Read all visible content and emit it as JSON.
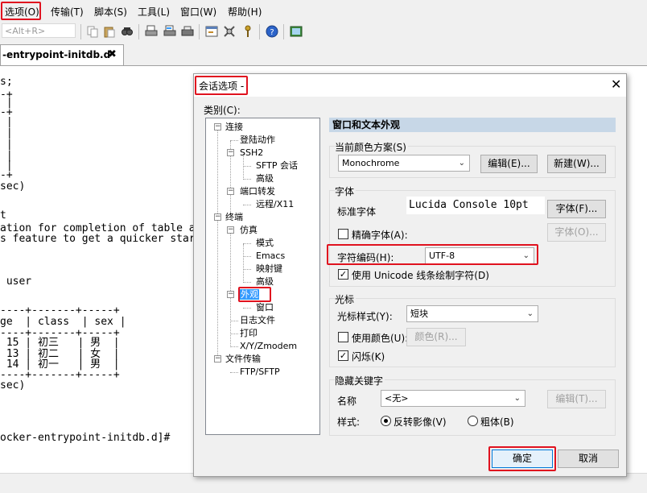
{
  "menubar": {
    "items": [
      {
        "label": "选项(O)"
      },
      {
        "label": "传输(T)"
      },
      {
        "label": "脚本(S)"
      },
      {
        "label": "工具(L)"
      },
      {
        "label": "窗口(W)"
      },
      {
        "label": "帮助(H)"
      }
    ]
  },
  "toolbar": {
    "hotkey_placeholder": "<Alt+R>"
  },
  "session_tab": {
    "label": "-entrypoint-initdb.d",
    "close": "✖"
  },
  "terminal": {
    "lines": [
      "s;",
      "-+",
      " |",
      "-+",
      " |",
      " |",
      " |",
      " |",
      " |",
      "-+",
      "sec)",
      "",
      "t",
      "ation for completion of table a",
      "s feature to get a quicker star",
      "",
      "",
      " user",
      "",
      "",
      "----+-------+-----+",
      "ge  | class  | sex |",
      "----+-------+-----+",
      " 15 | 初三   | 男  |",
      " 13 | 初二   | 女  |",
      " 14 | 初一   | 男  |",
      "----+-------+-----+",
      "sec)",
      "",
      "",
      "ocker-entrypoint-initdb.d]#"
    ]
  },
  "dialog": {
    "title": "会话选项 -",
    "close": "✕",
    "category_label": "类别(C):",
    "tree": [
      {
        "label": "连接"
      },
      {
        "label": "登陆动作"
      },
      {
        "label": "SSH2"
      },
      {
        "label": "SFTP 会话"
      },
      {
        "label": "高级"
      },
      {
        "label": "端口转发"
      },
      {
        "label": "远程/X11"
      },
      {
        "label": "终端"
      },
      {
        "label": "仿真"
      },
      {
        "label": "模式"
      },
      {
        "label": "Emacs"
      },
      {
        "label": "映射键"
      },
      {
        "label": "高级"
      },
      {
        "label": "外观"
      },
      {
        "label": "窗口"
      },
      {
        "label": "日志文件"
      },
      {
        "label": "打印"
      },
      {
        "label": "X/Y/Zmodem"
      },
      {
        "label": "文件传输"
      },
      {
        "label": "FTP/SFTP"
      }
    ],
    "pane_header": "窗口和文本外观",
    "color_scheme": {
      "group": "当前颜色方案(S)",
      "value": "Monochrome",
      "edit_button": "编辑(E)...",
      "new_button": "新建(W)..."
    },
    "font": {
      "group": "字体",
      "normal_font_label": "标准字体",
      "normal_font_value": "Lucida Console 10pt",
      "font_button": "字体(F)...",
      "precise_font_label": "精确字体(A):",
      "precise_font_button": "字体(O)...",
      "encoding_label": "字符编码(H):",
      "encoding_value": "UTF-8",
      "unicode_label": "使用 Unicode 线条绘制字符(D)"
    },
    "cursor": {
      "group": "光标",
      "style_label": "光标样式(Y):",
      "style_value": "短块",
      "use_color_label": "使用颜色(U):",
      "color_button": "颜色(R)...",
      "blink_label": "闪烁(K)"
    },
    "hidden_keyword": {
      "group": "隐藏关键字",
      "name_label": "名称",
      "name_value": "<无>",
      "edit_button": "编辑(T)...",
      "style_label": "样式:",
      "reverse_label": "反转影像(V)",
      "bold_label": "粗体(B)"
    },
    "ok_button": "确定",
    "cancel_button": "取消"
  },
  "colors": {
    "highlight_box": "#e0121f",
    "selection": "#3399ff",
    "pane_header": "#c7d7e7"
  }
}
